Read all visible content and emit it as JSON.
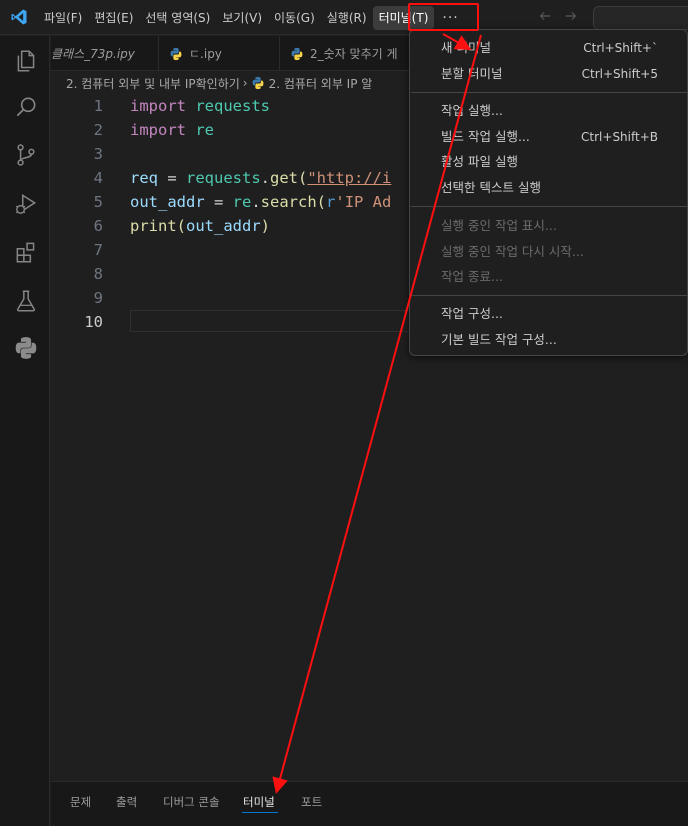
{
  "menubar": {
    "items": [
      "파일(F)",
      "편집(E)",
      "선택 영역(S)",
      "보기(V)",
      "이동(G)",
      "실행(R)",
      "터미널(T)"
    ],
    "more": "···"
  },
  "tabs": [
    "클래스_73p.ipy",
    "ㄷ.ipy",
    "2_숫자 맞추기 게"
  ],
  "breadcrumb": [
    "2. 컴퓨터 외부 및 내부 IP확인하기",
    "2. 컴퓨터 외부 IP 알"
  ],
  "editor": {
    "line_numbers": [
      "1",
      "2",
      "3",
      "4",
      "5",
      "6",
      "7",
      "8",
      "9",
      "10"
    ],
    "line1": {
      "kw": "import",
      "mod": "requests"
    },
    "line2": {
      "kw": "import",
      "mod": "re"
    },
    "line4": {
      "var": "req",
      "op": " = ",
      "mod": "requests",
      "dot": ".",
      "fn": "get",
      "paren": "(",
      "str": "\"http://i"
    },
    "line5": {
      "var": "out_addr",
      "op": " = ",
      "mod": "re",
      "dot": ".",
      "fn": "search",
      "paren": "(",
      "prefix": "r",
      "str": "'IP Ad"
    },
    "line6": {
      "fn": "print",
      "paren": "(",
      "var": "out_addr",
      "close": ")"
    }
  },
  "panel": {
    "tabs": [
      "문제",
      "출력",
      "디버그 콘솔",
      "터미널",
      "포트"
    ]
  },
  "dropdown": {
    "items": [
      {
        "label": "새 터미널",
        "shortcut": "Ctrl+Shift+`"
      },
      {
        "label": "분할 터미널",
        "shortcut": "Ctrl+Shift+5"
      },
      {
        "label": "작업 실행...",
        "shortcut": ""
      },
      {
        "label": "빌드 작업 실행...",
        "shortcut": "Ctrl+Shift+B"
      },
      {
        "label": "활성 파일 실행",
        "shortcut": ""
      },
      {
        "label": "선택한 텍스트 실행",
        "shortcut": ""
      },
      {
        "label": "실행 중인 작업 표시...",
        "shortcut": ""
      },
      {
        "label": "실행 중인 작업 다시 시작...",
        "shortcut": ""
      },
      {
        "label": "작업 종료...",
        "shortcut": ""
      },
      {
        "label": "작업 구성...",
        "shortcut": ""
      },
      {
        "label": "기본 빌드 작업 구성...",
        "shortcut": ""
      }
    ]
  },
  "colors": {
    "annotation": "#ff1010",
    "accent": "#0078d4"
  },
  "icons": [
    "vscode-logo",
    "explorer-icon",
    "search-icon",
    "source-control-icon",
    "run-debug-icon",
    "extensions-icon",
    "testing-icon",
    "python-icon",
    "back-arrow-icon",
    "forward-arrow-icon"
  ]
}
